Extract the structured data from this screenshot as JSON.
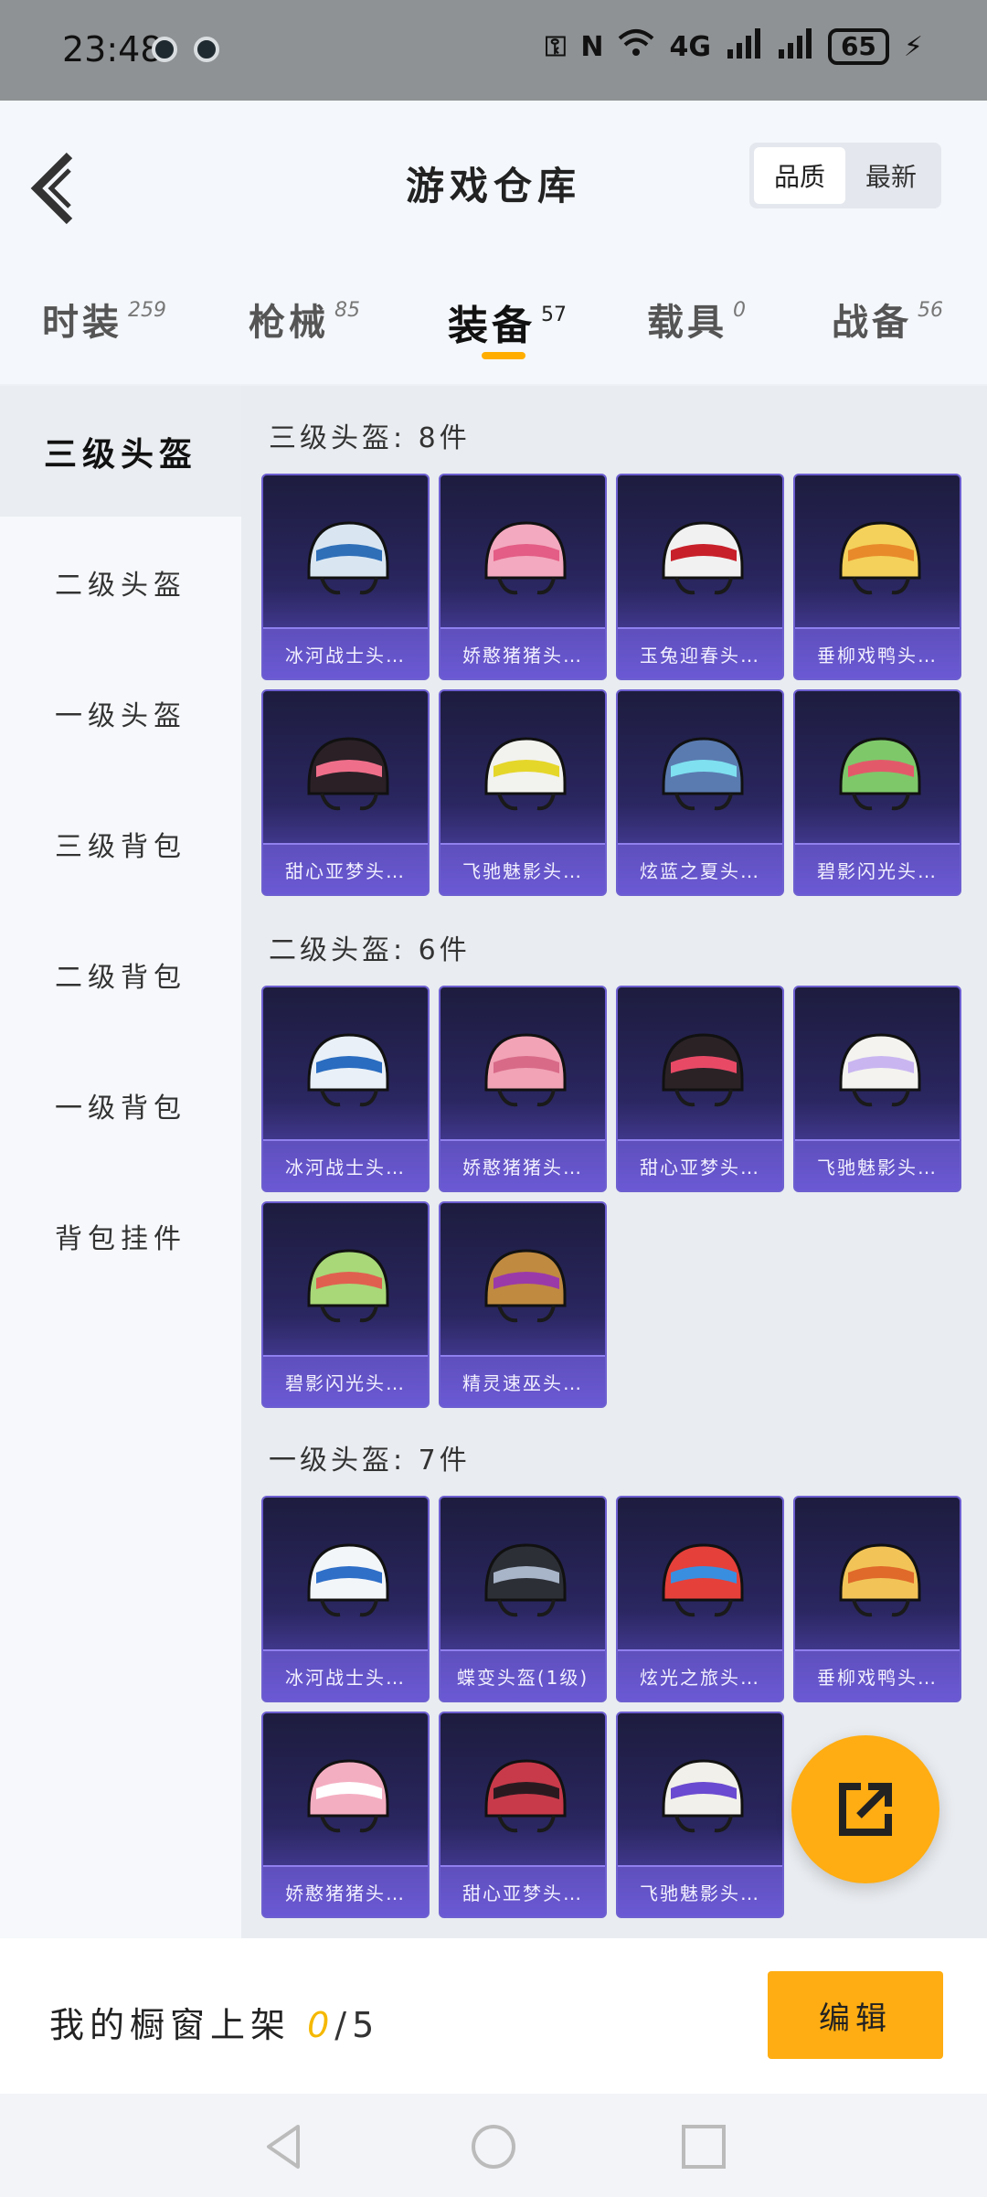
{
  "status_bar": {
    "time": "23:48",
    "network": "4G",
    "battery": "65"
  },
  "header": {
    "title": "游戏仓库",
    "sort_options": [
      "品质",
      "最新"
    ],
    "active_sort": "品质"
  },
  "tabs": [
    {
      "label": "时装",
      "count": "259"
    },
    {
      "label": "枪械",
      "count": "85"
    },
    {
      "label": "装备",
      "count": "57",
      "active": true
    },
    {
      "label": "载具",
      "count": "0"
    },
    {
      "label": "战备",
      "count": "56"
    }
  ],
  "sidebar": {
    "items": [
      "三级头盔",
      "二级头盔",
      "一级头盔",
      "三级背包",
      "二级背包",
      "一级背包",
      "背包挂件"
    ],
    "active": "三级头盔"
  },
  "sections": [
    {
      "title": "三级头盔: 8件",
      "items": [
        {
          "name": "冰河战士头…",
          "color": "#d9e6f2",
          "accent": "#2f6fb8"
        },
        {
          "name": "娇憨猪猪头…",
          "color": "#f3a9bf",
          "accent": "#e35d86"
        },
        {
          "name": "玉兔迎春头…",
          "color": "#f1f1f1",
          "accent": "#c8202a"
        },
        {
          "name": "垂柳戏鸭头…",
          "color": "#f4d15a",
          "accent": "#e88a2a"
        },
        {
          "name": "甜心亚梦头…",
          "color": "#2a2026",
          "accent": "#ef6f8a"
        },
        {
          "name": "飞驰魅影头…",
          "color": "#f2f2ee",
          "accent": "#e5d62a"
        },
        {
          "name": "炫蓝之夏头…",
          "color": "#5a7bb0",
          "accent": "#7fe0f0"
        },
        {
          "name": "碧影闪光头…",
          "color": "#7ec86a",
          "accent": "#e25a6a"
        }
      ]
    },
    {
      "title": "二级头盔: 6件",
      "items": [
        {
          "name": "冰河战士头…",
          "color": "#e9f0f7",
          "accent": "#2a6cc0"
        },
        {
          "name": "娇憨猪猪头…",
          "color": "#f2a3b6",
          "accent": "#d86a88"
        },
        {
          "name": "甜心亚梦头…",
          "color": "#2b2226",
          "accent": "#e84a66"
        },
        {
          "name": "飞驰魅影头…",
          "color": "#f4f3ef",
          "accent": "#c9b6f0"
        },
        {
          "name": "碧影闪光头…",
          "color": "#a8d878",
          "accent": "#e06050"
        },
        {
          "name": "精灵速巫头…",
          "color": "#c08a40",
          "accent": "#9a3aa8"
        }
      ]
    },
    {
      "title": "一级头盔: 7件",
      "items": [
        {
          "name": "冰河战士头…",
          "color": "#f3f6f9",
          "accent": "#2f6fc8"
        },
        {
          "name": "蝶变头盔(1级)",
          "color": "#2c2f36",
          "accent": "#a8b4c8"
        },
        {
          "name": "炫光之旅头…",
          "color": "#e5403a",
          "accent": "#3a8ee0"
        },
        {
          "name": "垂柳戏鸭头…",
          "color": "#f2c458",
          "accent": "#e06a2a"
        },
        {
          "name": "娇憨猪猪头…",
          "color": "#f4aec2",
          "accent": "#ffffff"
        },
        {
          "name": "甜心亚梦头…",
          "color": "#c83a4a",
          "accent": "#2a1a20"
        },
        {
          "name": "飞驰魅影头…",
          "color": "#f2f0ea",
          "accent": "#6a4ad0"
        }
      ]
    }
  ],
  "showcase": {
    "label": "我的橱窗上架",
    "count": "0",
    "total": "/5"
  },
  "edit_button": "编辑",
  "colors": {
    "accent": "#ffad12",
    "card_bg": "#2a2660",
    "card_border": "#6d5fd0"
  }
}
